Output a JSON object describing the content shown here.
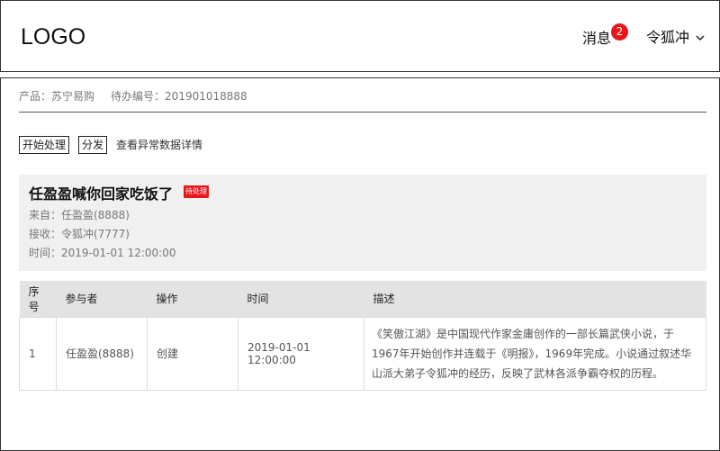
{
  "header": {
    "logo": "LOGO",
    "messages_label": "消息",
    "messages_count": "2",
    "user_name": "令狐冲",
    "user_menu_icon": "chevron-down-icon"
  },
  "breadcrumb": {
    "product_label": "产品：",
    "product_value": "苏宁易购",
    "todo_label": "待办编号：",
    "todo_value": "201901018888"
  },
  "actions": {
    "start_label": "开始处理",
    "dispatch_label": "分发",
    "details_link": "查看异常数据详情"
  },
  "task": {
    "title": "任盈盈喊你回家吃饭了",
    "status": "待处理",
    "from_label": "来自：",
    "from_value": "任盈盈(8888)",
    "to_label": "接收：",
    "to_value": "令狐冲(7777)",
    "time_label": "时间：",
    "time_value": "2019-01-01 12:00:00"
  },
  "table": {
    "columns": [
      "序号",
      "参与者",
      "操作",
      "时间",
      "描述"
    ],
    "rows": [
      {
        "index": "1",
        "participant": "任盈盈(8888)",
        "action": "创建",
        "time": "2019-01-01 12:00:00",
        "description": "《笑傲江湖》是中国现代作家金庸创作的一部长篇武侠小说，于1967年开始创作并连载于《明报》，1969年完成。小说通过叙述华山派大弟子令狐冲的经历，反映了武林各派争霸夺权的历程。"
      }
    ]
  },
  "colors": {
    "badge": "#e8161b",
    "status_tag": "#e8161b",
    "card_bg": "#f0f0f0",
    "table_header_bg": "#e3e3e3"
  }
}
